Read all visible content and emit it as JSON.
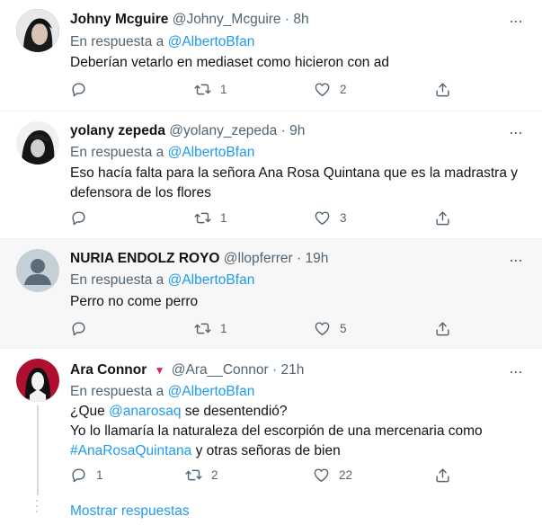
{
  "reply_prefix": "En respuesta a",
  "more_glyph": "···",
  "tweets": [
    {
      "name": "Johny Mcguire",
      "handle": "@Johny_Mcguire",
      "sep": "·",
      "time": "8h",
      "reply_to": "@AlbertoBfan",
      "text": "Deberían vetarlo en mediaset como hicieron con ad",
      "replies": "",
      "retweets": "1",
      "likes": "2"
    },
    {
      "name": "yolany zepeda",
      "handle": "@yolany_zepeda",
      "sep": "·",
      "time": "9h",
      "reply_to": "@AlbertoBfan",
      "text_line1": "Eso hacía falta para la señora Ana Rosa Quintana que es la madrastra y",
      "text_line2": "defensora de los flores",
      "replies": "",
      "retweets": "1",
      "likes": "3"
    },
    {
      "name": "NURIA ENDOLZ ROYO",
      "handle": "@llopferrer",
      "sep": "·",
      "time": "19h",
      "reply_to": "@AlbertoBfan",
      "text": "Perro no come perro",
      "replies": "",
      "retweets": "1",
      "likes": "5"
    },
    {
      "name": "Ara Connor",
      "badge": "▼",
      "handle": "@Ara__Connor",
      "sep": "·",
      "time": "21h",
      "reply_to": "@AlbertoBfan",
      "line1_pre": "¿Que ",
      "line1_mention": "@anarosaq",
      "line1_post": " se desentendió?",
      "line2": "Yo lo llamaría la naturaleza del escorpión de una mercenaria como",
      "line3_hashtag": "#AnaRosaQuintana",
      "line3_post": " y otras señoras de bien",
      "replies": "1",
      "retweets": "2",
      "likes": "22"
    }
  ],
  "show_replies": "Mostrar respuestas",
  "colors": {
    "link": "#1d9bf0",
    "muted": "#536471",
    "text": "#0f1419",
    "highlight_bg": "#f7f7f7",
    "badge": "#e0245e"
  }
}
